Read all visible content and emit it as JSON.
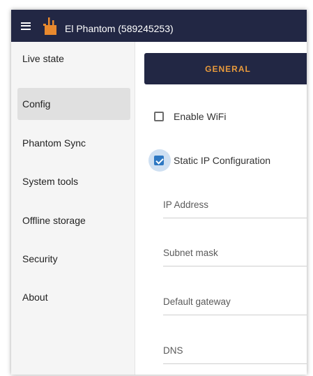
{
  "header": {
    "title": "El Phantom (589245253)",
    "menu_icon": "hamburger-menu-icon",
    "logo_icon": "phantom-logo-icon",
    "background_color": "#222744",
    "logo_color": "#e8892e"
  },
  "sidebar": {
    "items": [
      {
        "label": "Live state",
        "active": false
      },
      {
        "label": "Config",
        "active": true
      },
      {
        "label": "Phantom Sync",
        "active": false
      },
      {
        "label": "System tools",
        "active": false
      },
      {
        "label": "Offline storage",
        "active": false
      },
      {
        "label": "Security",
        "active": false
      },
      {
        "label": "About",
        "active": false
      }
    ]
  },
  "main": {
    "tab": {
      "label": "GENERAL",
      "text_color": "#e89a3c"
    },
    "checkboxes": [
      {
        "label": "Enable WiFi",
        "checked": false
      },
      {
        "label": "Static IP Configuration",
        "checked": true
      }
    ],
    "fields": [
      {
        "label": "IP Address",
        "value": ""
      },
      {
        "label": "Subnet mask",
        "value": ""
      },
      {
        "label": "Default gateway",
        "value": ""
      },
      {
        "label": "DNS",
        "value": ""
      }
    ],
    "accent_color": "#2e78c2"
  }
}
